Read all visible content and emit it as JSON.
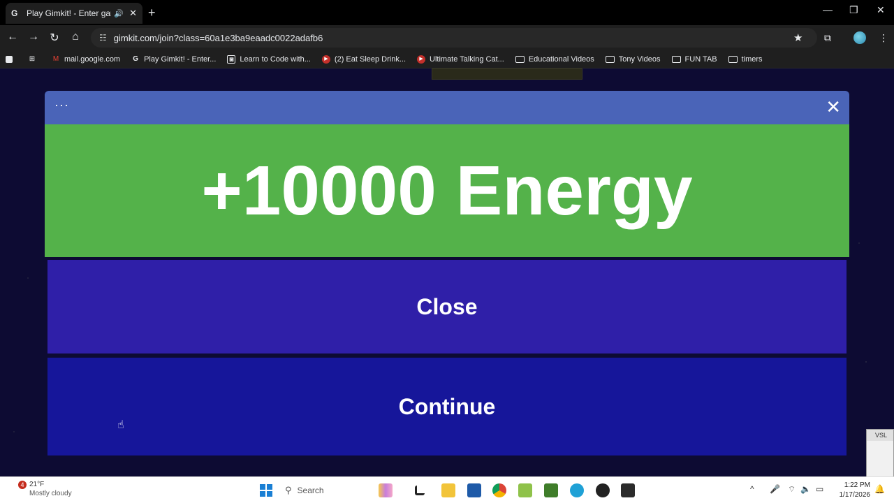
{
  "browser": {
    "tab_title": "Play Gimkit! - Enter game c",
    "tab_favicon": "G",
    "url": "gimkit.com/join?class=60a1e3ba9eaadc0022adafb6"
  },
  "bookmarks": [
    {
      "label": "mail.google.com",
      "icon": "gmail-icon"
    },
    {
      "label": "Play Gimkit! - Enter...",
      "icon": "gimkit-icon"
    },
    {
      "label": "Learn to Code with...",
      "icon": "code-icon"
    },
    {
      "label": "(2) Eat Sleep Drink...",
      "icon": "youtube-icon"
    },
    {
      "label": "Ultimate Talking Cat...",
      "icon": "youtube-icon"
    },
    {
      "label": "Educational Videos",
      "icon": "folder-icon"
    },
    {
      "label": "Tony Videos",
      "icon": "folder-icon"
    },
    {
      "label": "FUN TAB",
      "icon": "folder-icon"
    },
    {
      "label": "timers",
      "icon": "folder-icon"
    }
  ],
  "modal": {
    "menu_dots": "···",
    "close_x": "✕",
    "reward_text": "+10000 Energy",
    "close_label": "Close",
    "continue_label": "Continue",
    "header_color": "#4a64b8",
    "reward_color": "#54b24a",
    "close_color": "#2f1fa8",
    "continue_color": "#16169a"
  },
  "side_widget": {
    "label": "VSL"
  },
  "taskbar": {
    "weather_badge": "4",
    "temperature": "21°F",
    "condition": "Mostly cloudy",
    "search_label": "Search",
    "time": "1:22 PM",
    "date": "1/17/2026"
  }
}
